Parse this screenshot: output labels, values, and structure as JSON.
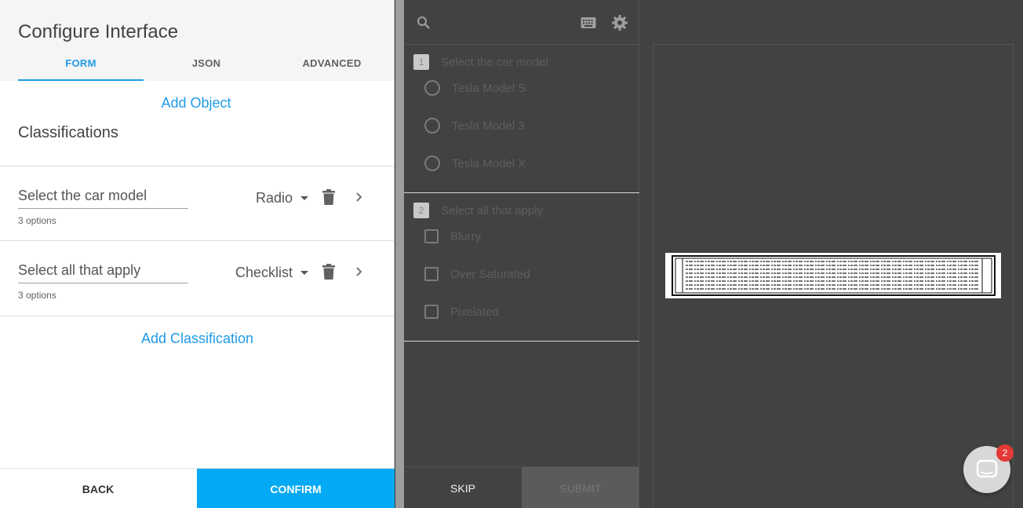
{
  "config": {
    "title": "Configure Interface",
    "tabs": [
      {
        "label": "FORM",
        "active": true
      },
      {
        "label": "JSON",
        "active": false
      },
      {
        "label": "ADVANCED",
        "active": false
      }
    ],
    "add_object_label": "Add Object",
    "section_title": "Classifications",
    "classifications": [
      {
        "name": "Select the car model",
        "options_count": "3 options",
        "type": "Radio"
      },
      {
        "name": "Select all that apply",
        "options_count": "3 options",
        "type": "Checklist"
      }
    ],
    "add_classification_label": "Add Classification",
    "back_label": "BACK",
    "confirm_label": "CONFIRM"
  },
  "labeling": {
    "questions": [
      {
        "number": "1",
        "text": "Select the car model",
        "kind": "radio",
        "options": [
          "Tesla Model S",
          "Tesla Model 3",
          "Tesla Model X"
        ]
      },
      {
        "number": "2",
        "text": "Select all that apply",
        "kind": "checkbox",
        "options": [
          "Blurry",
          "Over Saturated",
          "Pixelated"
        ]
      }
    ],
    "skip_label": "SKIP",
    "submit_label": "SUBMIT"
  },
  "chat": {
    "badge_count": "2"
  },
  "colors": {
    "accent": "#1e9be9",
    "confirm": "#03a9f4",
    "panel_dark": "#424242",
    "badge": "#e53935"
  }
}
